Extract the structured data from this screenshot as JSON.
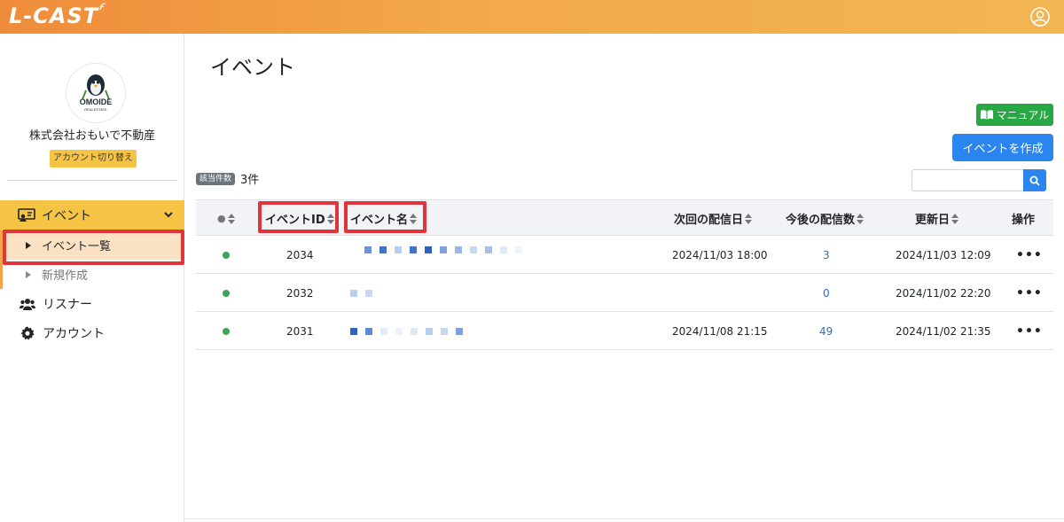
{
  "app": {
    "logo_text": "L-CAST"
  },
  "colors": {
    "header_start": "#ef8c3a",
    "header_end": "#f3b552",
    "nav_active": "#f5c445",
    "primary": "#2a85ee",
    "success": "#28a745",
    "highlight": "#e0353a",
    "status_active": "#3ba55c"
  },
  "sidebar": {
    "avatar_text": "OMOIDE",
    "avatar_subtext": "REALESTATE",
    "company_name": "株式会社おもいで不動産",
    "switch_account_label": "アカウント切り替え",
    "nav": {
      "event": {
        "label": "イベント",
        "icon": "event-icon"
      },
      "event_list": {
        "label": "イベント一覧"
      },
      "event_new": {
        "label": "新規作成"
      },
      "listener": {
        "label": "リスナー",
        "icon": "users-icon"
      },
      "account": {
        "label": "アカウント",
        "icon": "gear-icon"
      }
    }
  },
  "main": {
    "title": "イベント",
    "manual_button": "マニュアル",
    "create_button": "イベントを作成",
    "count_badge": "該当件数",
    "count_text": "3件",
    "search": {
      "value": "",
      "placeholder": ""
    }
  },
  "table": {
    "headers": {
      "status": "●",
      "event_id": "イベントID",
      "event_name": "イベント名",
      "next_date": "次回の配信日",
      "upcoming": "今後の配信数",
      "updated": "更新日",
      "actions": "操作"
    },
    "rows": [
      {
        "status": "active",
        "id": "2034",
        "name": "",
        "next_date": "2024/11/03 18:00",
        "upcoming": "3",
        "updated": "2024/11/03 12:09",
        "actions": "•••"
      },
      {
        "status": "active",
        "id": "2032",
        "name": "",
        "next_date": "",
        "upcoming": "0",
        "updated": "2024/11/02 22:20",
        "actions": "•••"
      },
      {
        "status": "active",
        "id": "2031",
        "name": "",
        "next_date": "2024/11/08 21:15",
        "upcoming": "49",
        "updated": "2024/11/02 21:35",
        "actions": "•••"
      }
    ]
  }
}
